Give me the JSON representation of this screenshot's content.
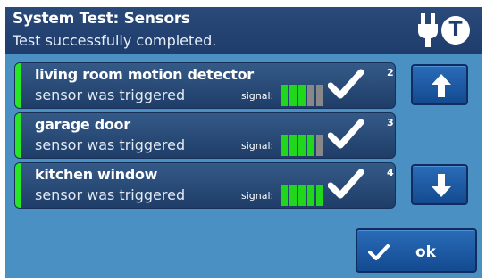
{
  "header": {
    "title": "System Test: Sensors",
    "status": "Test successfully completed.",
    "icons": [
      "plug-icon",
      "t-icon"
    ],
    "t_icon_letter": "T"
  },
  "signal_label": "signal:",
  "sensors": [
    {
      "name": "living room motion detector",
      "state": "sensor was triggered",
      "signal_level": 3,
      "signal_max": 5,
      "index": "2"
    },
    {
      "name": "garage door",
      "state": "sensor was triggered",
      "signal_level": 4,
      "signal_max": 5,
      "index": "3"
    },
    {
      "name": "kitchen window",
      "state": "sensor was triggered",
      "signal_level": 5,
      "signal_max": 5,
      "index": "4"
    }
  ],
  "buttons": {
    "scroll_up_icon": "arrow-up-icon",
    "scroll_down_icon": "arrow-down-icon",
    "ok_label": "ok"
  },
  "colors": {
    "header_bg": "#1e3c6c",
    "screen_bg": "#4a90c2",
    "row_bg": "#2a4a7a",
    "indicator_green": "#27e626",
    "signal_on": "#21d71c",
    "signal_off": "#888888",
    "button_bg": "#1f5aa3"
  }
}
